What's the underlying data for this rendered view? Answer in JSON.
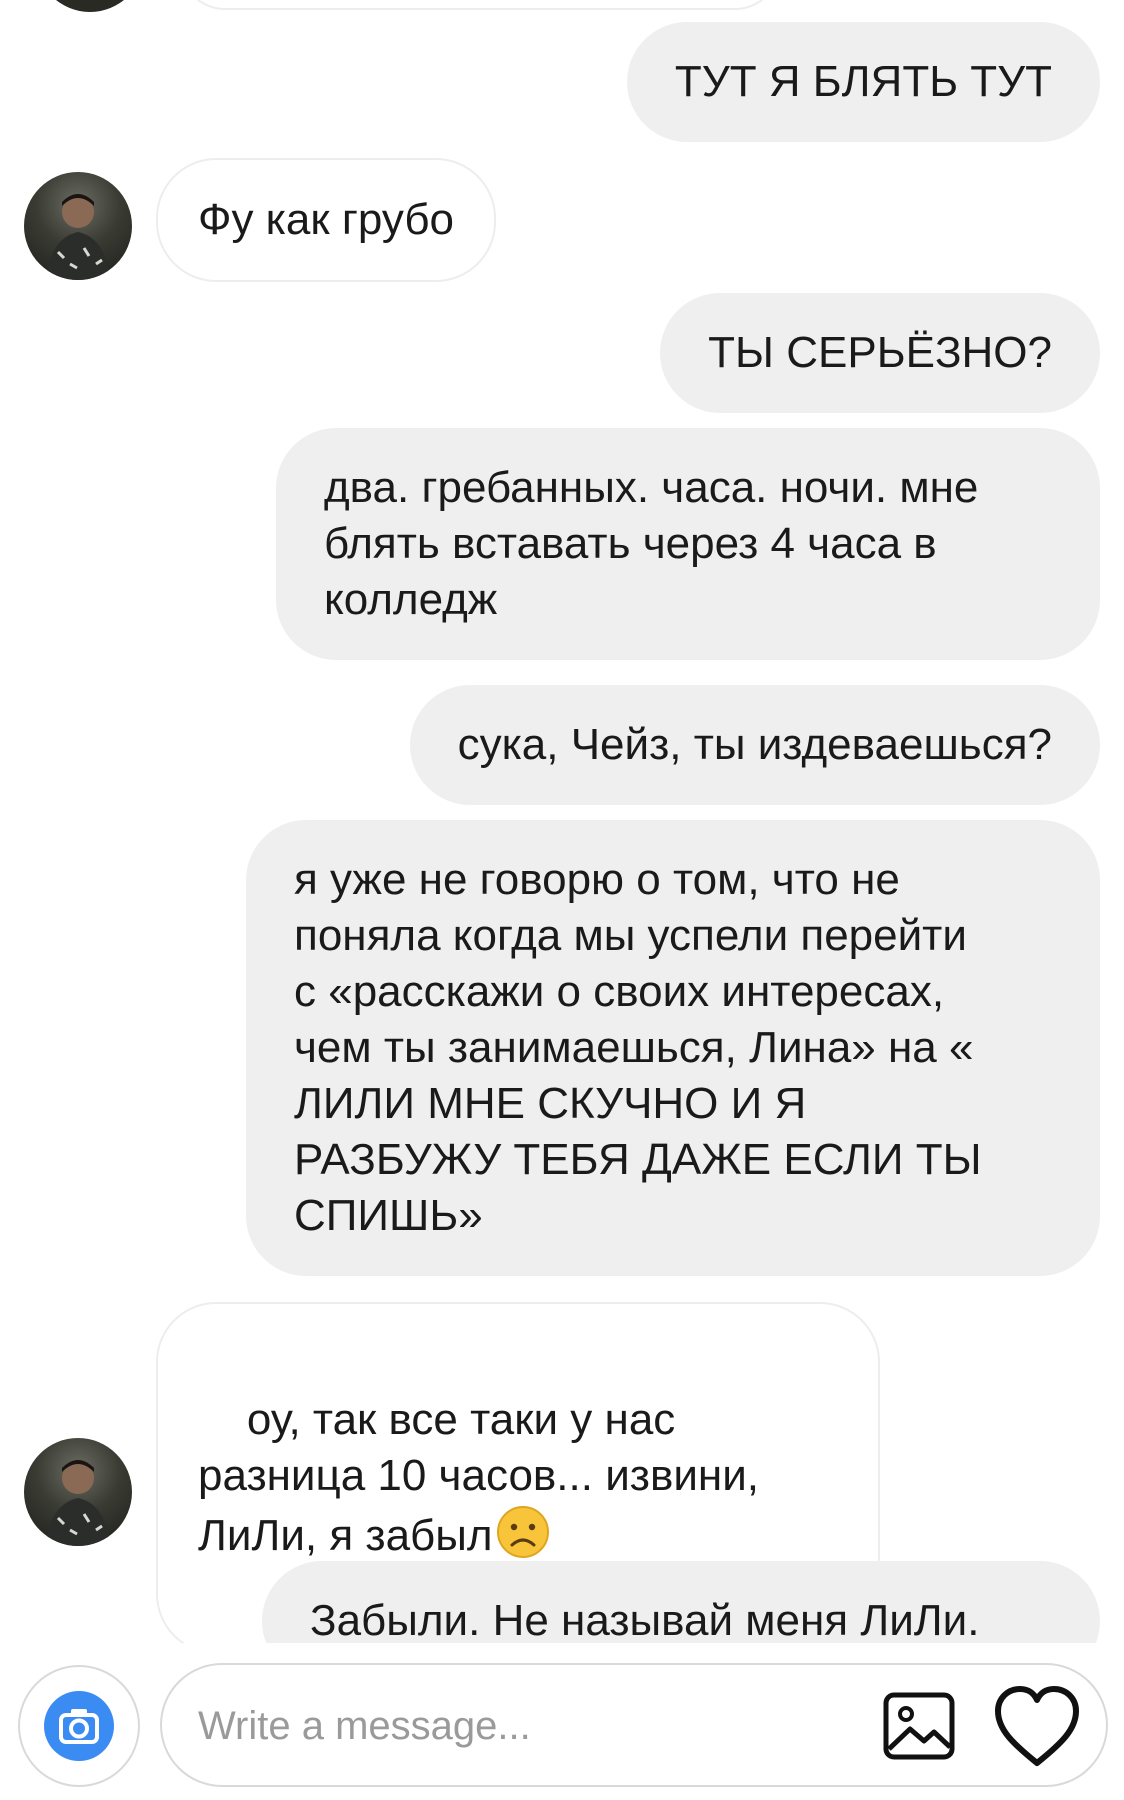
{
  "conversation": {
    "messages": [
      {
        "direction": "out",
        "text": "ТУТ Я БЛЯТЬ ТУТ"
      },
      {
        "direction": "in",
        "text": "Фу как грубо"
      },
      {
        "direction": "out",
        "text": "ТЫ СЕРЬЁЗНО?"
      },
      {
        "direction": "out",
        "text": "два. гребанных. часа. ночи. мне\nблять вставать через 4 часа в\nколледж"
      },
      {
        "direction": "out",
        "text": "сука, Чейз, ты издеваешься?"
      },
      {
        "direction": "out",
        "text": "я уже не говорю о том, что не\nпоняла когда мы успели перейти\nс «расскажи о своих интересах,\nчем ты занимаешься, Лина» на «\nЛИЛИ МНЕ СКУЧНО И Я\nРАЗБУЖУ ТЕБЯ ДАЖЕ ЕСЛИ ТЫ\nСПИШЬ»"
      },
      {
        "direction": "in",
        "text": "оу, так все таки у нас\nразница 10 часов... извини,\nЛиЛи, я забыл",
        "emoji": "frowning-face"
      },
      {
        "direction": "out",
        "text": "Забыли. Не называй меня ЛиЛи."
      }
    ]
  },
  "composer": {
    "placeholder": "Write a message...",
    "value": "",
    "camera_icon": "camera-icon",
    "gallery_icon": "image-gallery-icon",
    "like_icon": "heart-icon"
  },
  "colors": {
    "outgoing_bubble": "#efefef",
    "incoming_border": "#ededed",
    "camera_accent": "#3b8cf2",
    "placeholder": "#9a9a9a"
  }
}
